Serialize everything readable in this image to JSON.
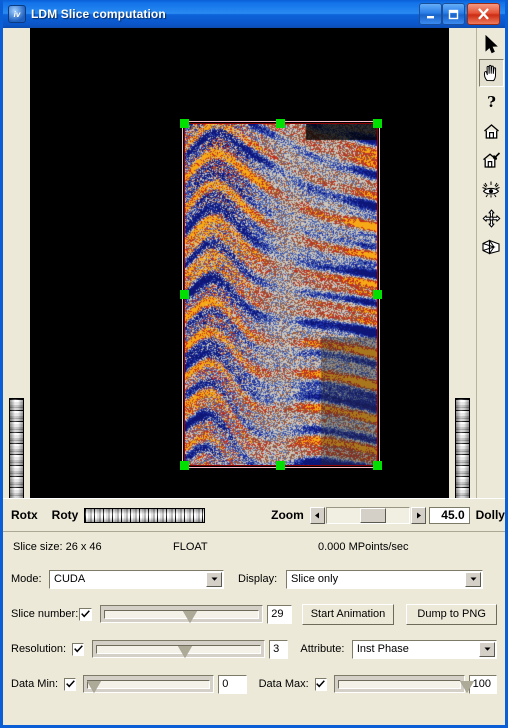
{
  "window": {
    "title": "LDM Slice computation",
    "icon": "iv-logo-icon",
    "minimize_label": "Minimize",
    "maximize_label": "Maximize",
    "close_label": "Close"
  },
  "toolbar": {
    "items": [
      {
        "name": "pointer-icon",
        "tooltip": "Pick",
        "pressed": false
      },
      {
        "name": "hand-icon",
        "tooltip": "View",
        "pressed": true
      },
      {
        "name": "question-mark-icon",
        "tooltip": "Help",
        "pressed": false
      },
      {
        "name": "home-icon",
        "tooltip": "Home",
        "pressed": false
      },
      {
        "name": "set-home-icon",
        "tooltip": "Set home",
        "pressed": false
      },
      {
        "name": "view-all-icon",
        "tooltip": "View all",
        "pressed": false
      },
      {
        "name": "seek-icon",
        "tooltip": "Seek",
        "pressed": false
      },
      {
        "name": "perspective-camera-icon",
        "tooltip": "Camera toggle",
        "pressed": false
      }
    ]
  },
  "viewer": {
    "rotx_label": "Rotx",
    "roty_label": "Roty",
    "zoom_label": "Zoom",
    "zoom_value": "45.0",
    "dolly_label": "Dolly",
    "left_arrow": "◄",
    "right_arrow": "►"
  },
  "status": {
    "slice_size": "Slice size: 26 x 46",
    "data_type": "FLOAT",
    "throughput": "0.000 MPoints/sec"
  },
  "panel": {
    "mode": {
      "label": "Mode:",
      "value": "CUDA"
    },
    "display": {
      "label": "Display:",
      "value": "Slice only"
    },
    "slice_number": {
      "label": "Slice number:",
      "checked": true,
      "value": "29",
      "percent": 50
    },
    "start_animation_label": "Start Animation",
    "dump_png_label": "Dump to PNG",
    "resolution": {
      "label": "Resolution:",
      "checked": true,
      "value": "3",
      "percent": 50
    },
    "attribute": {
      "label": "Attribute:",
      "value": "Inst Phase"
    },
    "data_min": {
      "label": "Data Min:",
      "checked": true,
      "value": "0",
      "percent": 0
    },
    "data_max": {
      "label": "Data Max:",
      "checked": true,
      "value": "100",
      "percent": 100
    }
  },
  "colors": {
    "titlebar_blue": "#0a5fd6",
    "face": "#ece9d8",
    "canvas": "#000000",
    "handle_green": "#00e000",
    "selection_frame": "#ffc0cb"
  }
}
